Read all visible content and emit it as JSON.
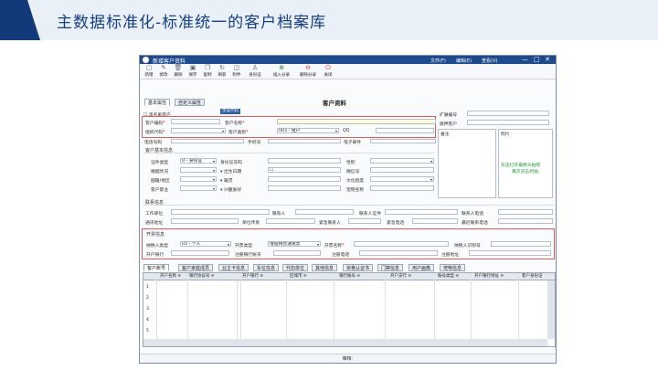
{
  "slide_title": "主数据标准化-标准统一的客户档案库",
  "window": {
    "title": "新增客户资料",
    "menus": [
      "文件(F)",
      "编辑(E)",
      "查看(V)"
    ],
    "controls": [
      "—",
      "□",
      "✕"
    ]
  },
  "toolbar": [
    {
      "label": "新增",
      "icon": "new-icon"
    },
    {
      "label": "修改",
      "icon": "edit-icon"
    },
    {
      "label": "删除",
      "icon": "delete-icon"
    },
    {
      "label": "保存",
      "icon": "save-icon"
    },
    {
      "label": "复制",
      "icon": "copy-icon"
    },
    {
      "label": "刷新",
      "icon": "refresh-icon"
    },
    {
      "label": "附件",
      "icon": "attachment-icon"
    },
    {
      "label": "身份证",
      "icon": "id-card-icon"
    },
    {
      "label": "插入分录",
      "icon": "insert-row-icon"
    },
    {
      "label": "删除分录",
      "icon": "delete-row-icon"
    },
    {
      "label": "关闭",
      "icon": "close-icon"
    }
  ],
  "tabs_top": [
    "基本属性",
    "自定义属性"
  ],
  "form_title": "客户资料",
  "gen_code_button": "生成代码",
  "checkbox_personal": "黑名单客户",
  "fields": {
    "customer_code": "客户编码",
    "customer_name": "客户名称",
    "org_code": "组织代码",
    "customer_category": "客户类别",
    "customer_category_value": "003 - 租户",
    "qq": "QQ",
    "phone": "电话号码",
    "mobile": "手机号",
    "email": "电子邮件",
    "ext_code": "扩展编号",
    "subsidiary_customer": "质押客户",
    "remarks": "备注",
    "photo": "照片",
    "photo_hint_1": "双击打开摄像头拍照",
    "photo_hint_2": "再次双击抓拍"
  },
  "basic_info": {
    "section": "客户基本信息",
    "id_type": "证件类型",
    "id_type_value": "0 - 身份证",
    "id_number": "身份证号码",
    "gender": "性别",
    "marital": "婚姻状况",
    "birth_date": "出生日期",
    "wechat": "微信号",
    "country": "国籍/地区",
    "native_place": "籍贯",
    "education": "文化程度",
    "occupation": "客户职业",
    "hobby": "兴趣爱好",
    "nickname": "宠物名称"
  },
  "contact": {
    "section": "联系信息",
    "work_unit": "工作单位",
    "contact_person": "联系人",
    "contact_id": "联系人证件",
    "contact_phone": "联系人电话",
    "address": "通讯地址",
    "unit_fax": "单位传真",
    "emergency_contact": "紧急联系人",
    "emergency_phone": "紧急电话",
    "recent_contact_phone": "最近联系电话"
  },
  "invoice": {
    "section": "开票信息",
    "taxpayer_type": "纳税人类型",
    "taxpayer_type_value": "03 - 个人",
    "invoice_type": "开票类型",
    "invoice_type_value": "增值税普通发票",
    "invoice_name": "开票名称",
    "taxpayer_id": "纳税人识别号",
    "bank": "开户银行",
    "bank_account": "注册银行账号",
    "reg_phone": "注册电话",
    "reg_address": "注册地址"
  },
  "tabs_bottom": [
    "客户账号",
    "客户家庭成员",
    "业主卡信息",
    "车位信息",
    "代扣单位",
    "其他信息",
    "资格认证书",
    "门禁信息",
    "用户画像",
    "宠物信息"
  ],
  "grid_columns": [
    "开户名称",
    "银行协议号",
    "开户银行",
    "区域市",
    "银行账号",
    "开户支行",
    "账号类型",
    "开户银行地址",
    "客户身份证"
  ],
  "grid_rows": [
    "1",
    "2",
    "3",
    "4",
    "5"
  ],
  "status": "审核:"
}
